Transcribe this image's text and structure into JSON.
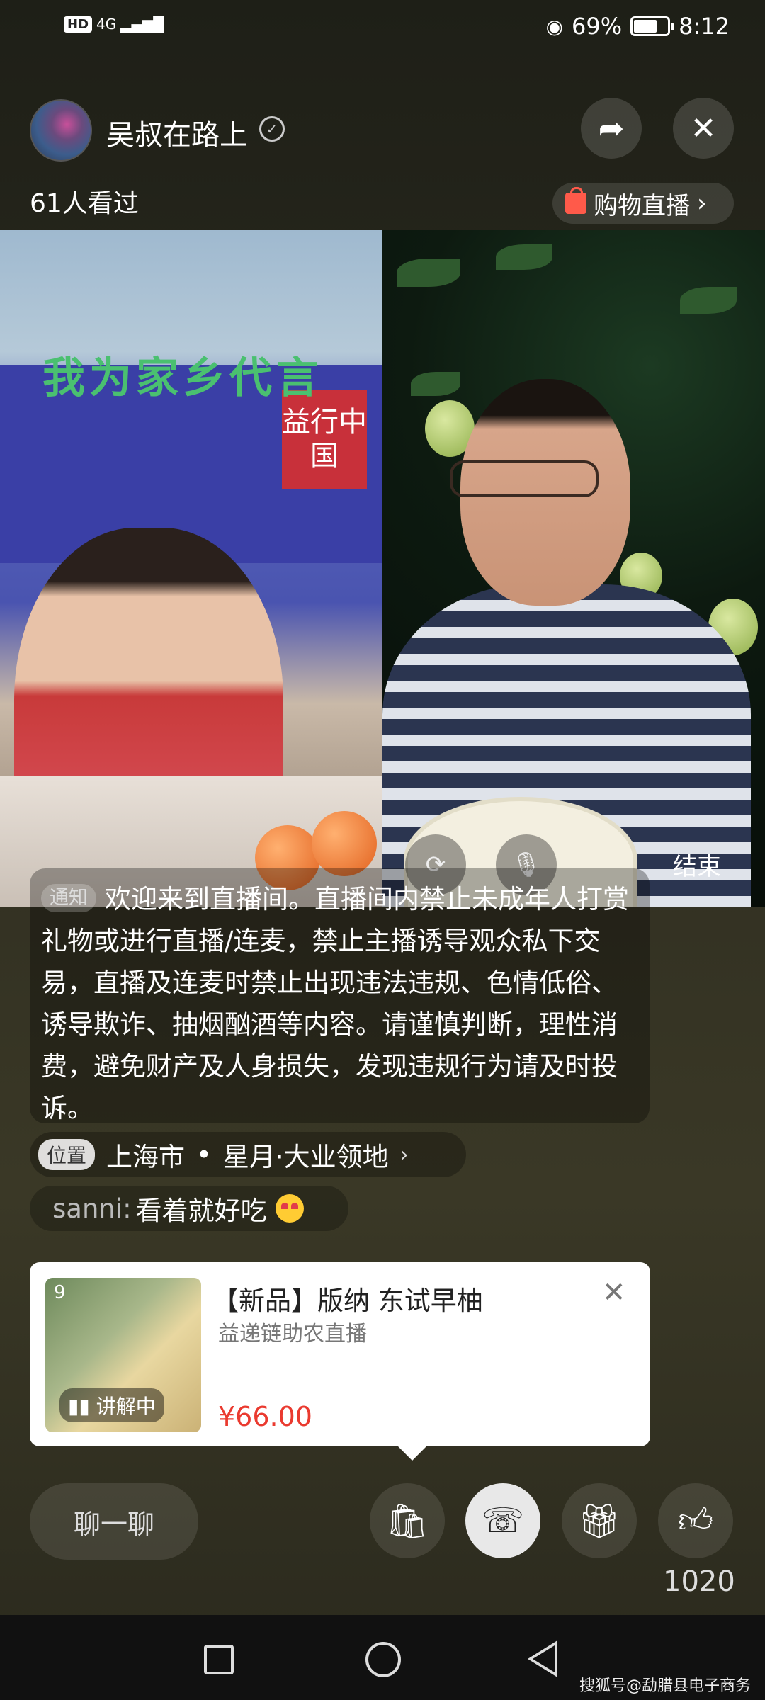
{
  "status_bar": {
    "hd": "HD",
    "network": "4G",
    "battery_text": "69%",
    "battery_level": 0.69,
    "time": "8:12"
  },
  "header": {
    "host_name": "吴叔在路上",
    "view_count": "61人看过",
    "shop_label": "购物直播",
    "shop_chevron": "›"
  },
  "video": {
    "banner_text": "我为家乡代言",
    "banner_logo": "益行中国",
    "end_label": "结束"
  },
  "notice": {
    "tag": "通知",
    "text": "欢迎来到直播间。直播间内禁止未成年人打赏礼物或进行直播/连麦，禁止主播诱导观众私下交易，直播及连麦时禁止出现违法违规、色情低俗、诱导欺诈、抽烟酗酒等内容。请谨慎判断，理性消费，避免财产及人身损失，发现违规行为请及时投诉。"
  },
  "location": {
    "tag": "位置",
    "city": "上海市",
    "separator": "•",
    "place": "星月·大业领地",
    "chevron": "›"
  },
  "comment": {
    "user": "sanni:",
    "text": "看着就好吃"
  },
  "product": {
    "index": "9",
    "badge": "讲解中",
    "title": "【新品】版纳 东试早柚",
    "subtitle": "益递链助农直播",
    "price": "¥66.00",
    "close": "✕"
  },
  "bottom_bar": {
    "chat_label": "聊一聊",
    "likes": "1020"
  },
  "watermark": "搜狐号@勐腊县电子商务",
  "icons": [
    "share-icon",
    "close-icon",
    "verified-icon",
    "shopping-bag-icon",
    "camera-flip-icon",
    "mic-off-icon",
    "video-call-icon",
    "gift-icon",
    "thumbs-up-icon"
  ]
}
